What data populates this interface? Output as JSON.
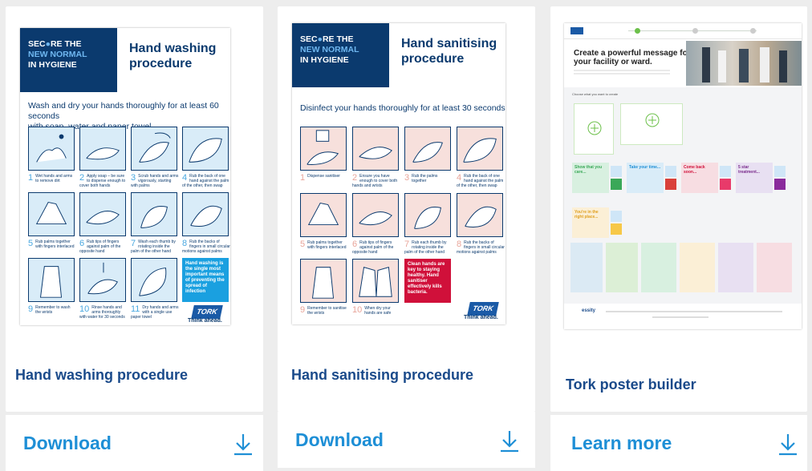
{
  "cards": [
    {
      "title": "Hand washing procedure",
      "action_label": "Download",
      "action_icon": "download-arrow-icon",
      "poster": {
        "secure": [
          "SEC",
          "RE THE",
          "NEW NORMAL",
          "IN HYGIENE"
        ],
        "title_line1": "Hand washing",
        "title_line2": "procedure",
        "subtitle_line1": "Wash and dry your hands thoroughly for at least 60 seconds",
        "subtitle_line2": "with soap, water and paper towel",
        "steps": [
          {
            "num": "1",
            "text": "Wet hands and arms to remove dirt"
          },
          {
            "num": "2",
            "text": "Apply soap – be sure to disperse enough to cover both hands"
          },
          {
            "num": "3",
            "text": "Scrub hands and arms vigorously, starting with palms"
          },
          {
            "num": "4",
            "text": "Rub the back of one hand against the palm of the other, then swap"
          },
          {
            "num": "5",
            "text": "Rub palms together with fingers interlaced"
          },
          {
            "num": "6",
            "text": "Rub tips of fingers against palm of the opposite hand"
          },
          {
            "num": "7",
            "text": "Wash each thumb by rotating inside the palm of the other hand"
          },
          {
            "num": "8",
            "text": "Rub the backs of fingers in small circular motions against palms"
          },
          {
            "num": "9",
            "text": "Remember to wash the wrists"
          },
          {
            "num": "10",
            "text": "Rinse hands and arms thoroughly with water for 30 seconds"
          },
          {
            "num": "11",
            "text": "Dry hands and arms with a single use paper towel"
          }
        ],
        "callout": "Hand washing is the single most important means of preventing the spread of infection",
        "logo": "TORK",
        "tagline": "Think ahead."
      }
    },
    {
      "title": "Hand sanitising procedure",
      "action_label": "Download",
      "action_icon": "download-arrow-icon",
      "poster": {
        "secure": [
          "SEC",
          "RE THE",
          "NEW NORMAL",
          "IN HYGIENE"
        ],
        "title_line1": "Hand sanitising",
        "title_line2": "procedure",
        "subtitle_line1": "Disinfect your hands thoroughly for at least 30 seconds",
        "steps": [
          {
            "num": "1",
            "text": "Dispense sanitiser"
          },
          {
            "num": "2",
            "text": "Ensure you have enough to cover both hands and wrists"
          },
          {
            "num": "3",
            "text": "Rub the palms together"
          },
          {
            "num": "4",
            "text": "Rub the back of one hand against the palm of the other, then swap"
          },
          {
            "num": "5",
            "text": "Rub palms together with fingers interlaced"
          },
          {
            "num": "6",
            "text": "Rub tips of fingers against palm of the opposite hand"
          },
          {
            "num": "7",
            "text": "Rub each thumb by rotating inside the palm of the other hand"
          },
          {
            "num": "8",
            "text": "Rub the backs of fingers in small circular motions against palms"
          },
          {
            "num": "9",
            "text": "Remember to sanitise the wrists"
          },
          {
            "num": "10",
            "text": "When dry your hands are safe"
          }
        ],
        "callout": "Clean hands are key to staying healthy. Hand sanitiser effectively kills bacteria.",
        "logo": "TORK",
        "tagline": "Think ahead."
      }
    },
    {
      "title": "Tork poster builder",
      "action_label": "Learn more",
      "action_icon": "download-arrow-icon",
      "builder": {
        "headline": "Create a powerful message for your facility or ward.",
        "section_label": "Choose what you want to create",
        "tiles": [
          "Show that you care...",
          "Take your time...",
          "Come back soon...",
          "5 star treatment...",
          "You're in the right place..."
        ],
        "footer_brand": "essity"
      }
    }
  ],
  "colors": {
    "title_blue": "#1a4a8a",
    "action_blue": "#1e8fd6",
    "poster_navy": "#0b3a6e",
    "washing_tile": "#d9ecf8",
    "sanitising_tile": "#f7e0dc",
    "callout_cyan": "#1aa0e0",
    "callout_red": "#d0103a"
  }
}
